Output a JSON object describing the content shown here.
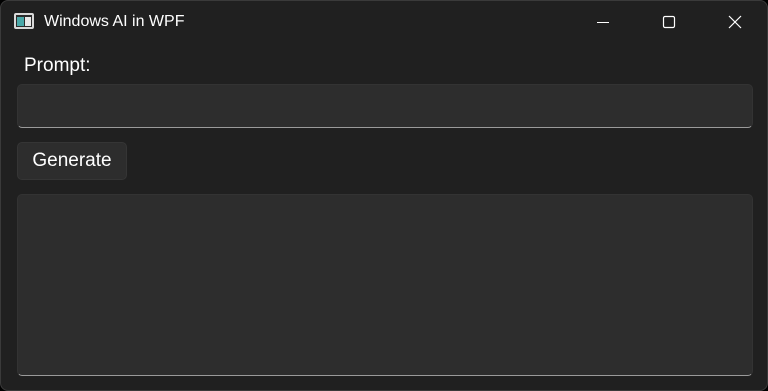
{
  "window": {
    "title": "Windows AI in WPF",
    "icon": "wpf-app-icon"
  },
  "caption_buttons": {
    "minimize_icon": "minimize-icon",
    "maximize_icon": "maximize-icon",
    "close_icon": "close-icon"
  },
  "form": {
    "prompt_label": "Prompt:",
    "prompt_value": "",
    "generate_label": "Generate",
    "output_value": ""
  },
  "colors": {
    "background": "#202020",
    "control_fill": "#2d2d2d",
    "underline": "#9a9a9a",
    "text": "#ffffff"
  }
}
